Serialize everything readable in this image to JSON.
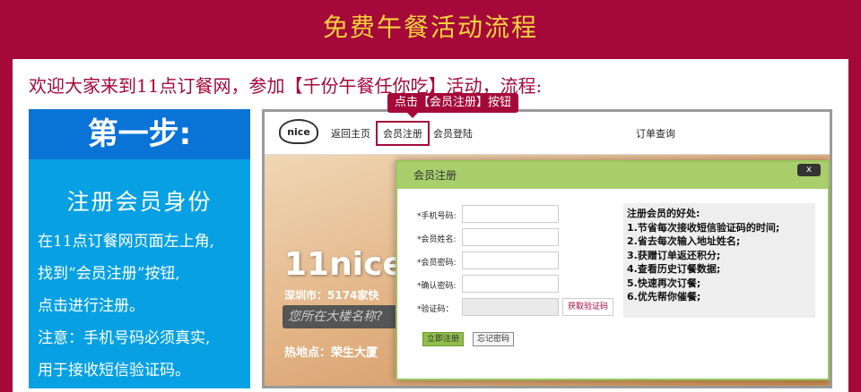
{
  "banner": {
    "title": "免费午餐活动流程"
  },
  "intro": "欢迎大家来到11点订餐网，参加【千份午餐任你吃】活动，流程:",
  "step": {
    "heading": "第一步:",
    "subheading": "注册会员身份",
    "lines": [
      "在11点订餐网页面左上角,",
      "找到“会员注册”按钮,",
      "点击进行注册。",
      "注意：手机号码必须真实,",
      "用于接收短信验证码。"
    ]
  },
  "callout": "点击【会员注册】按钮",
  "site": {
    "logo": "nice",
    "nav": {
      "home": "返回主页",
      "register": "会员注册",
      "login": "会员登陆",
      "order_query": "订单查询"
    },
    "hero": {
      "brand": "11nice",
      "city": "深圳市：5174家快",
      "search_placeholder": "您所在大楼名称?",
      "hot": "热地点：荣生大厦"
    }
  },
  "modal": {
    "title": "会员注册",
    "close": "x",
    "fields": [
      {
        "label": "*手机号码:"
      },
      {
        "label": "*会员姓名:"
      },
      {
        "label": "*会员密码:"
      },
      {
        "label": "*确认密码:"
      },
      {
        "label": "*验证码："
      }
    ],
    "get_code": "获取验证码",
    "submit": "立即注册",
    "forgot": "忘记密码",
    "benefits": [
      "注册会员的好处:",
      "1.节省每次接收短信验证码的时间;",
      "2.省去每次输入地址姓名;",
      "3.获赠订单返还积分;",
      "4.查看历史订餐数据;",
      "5.快速再次订餐;",
      "6.优先帮你催餐;"
    ]
  },
  "colors": {
    "brand": "#a5093a",
    "title_gold": "#f5d23c",
    "step_blue": "#07a0e3",
    "modal_green": "#a8cf6c"
  }
}
